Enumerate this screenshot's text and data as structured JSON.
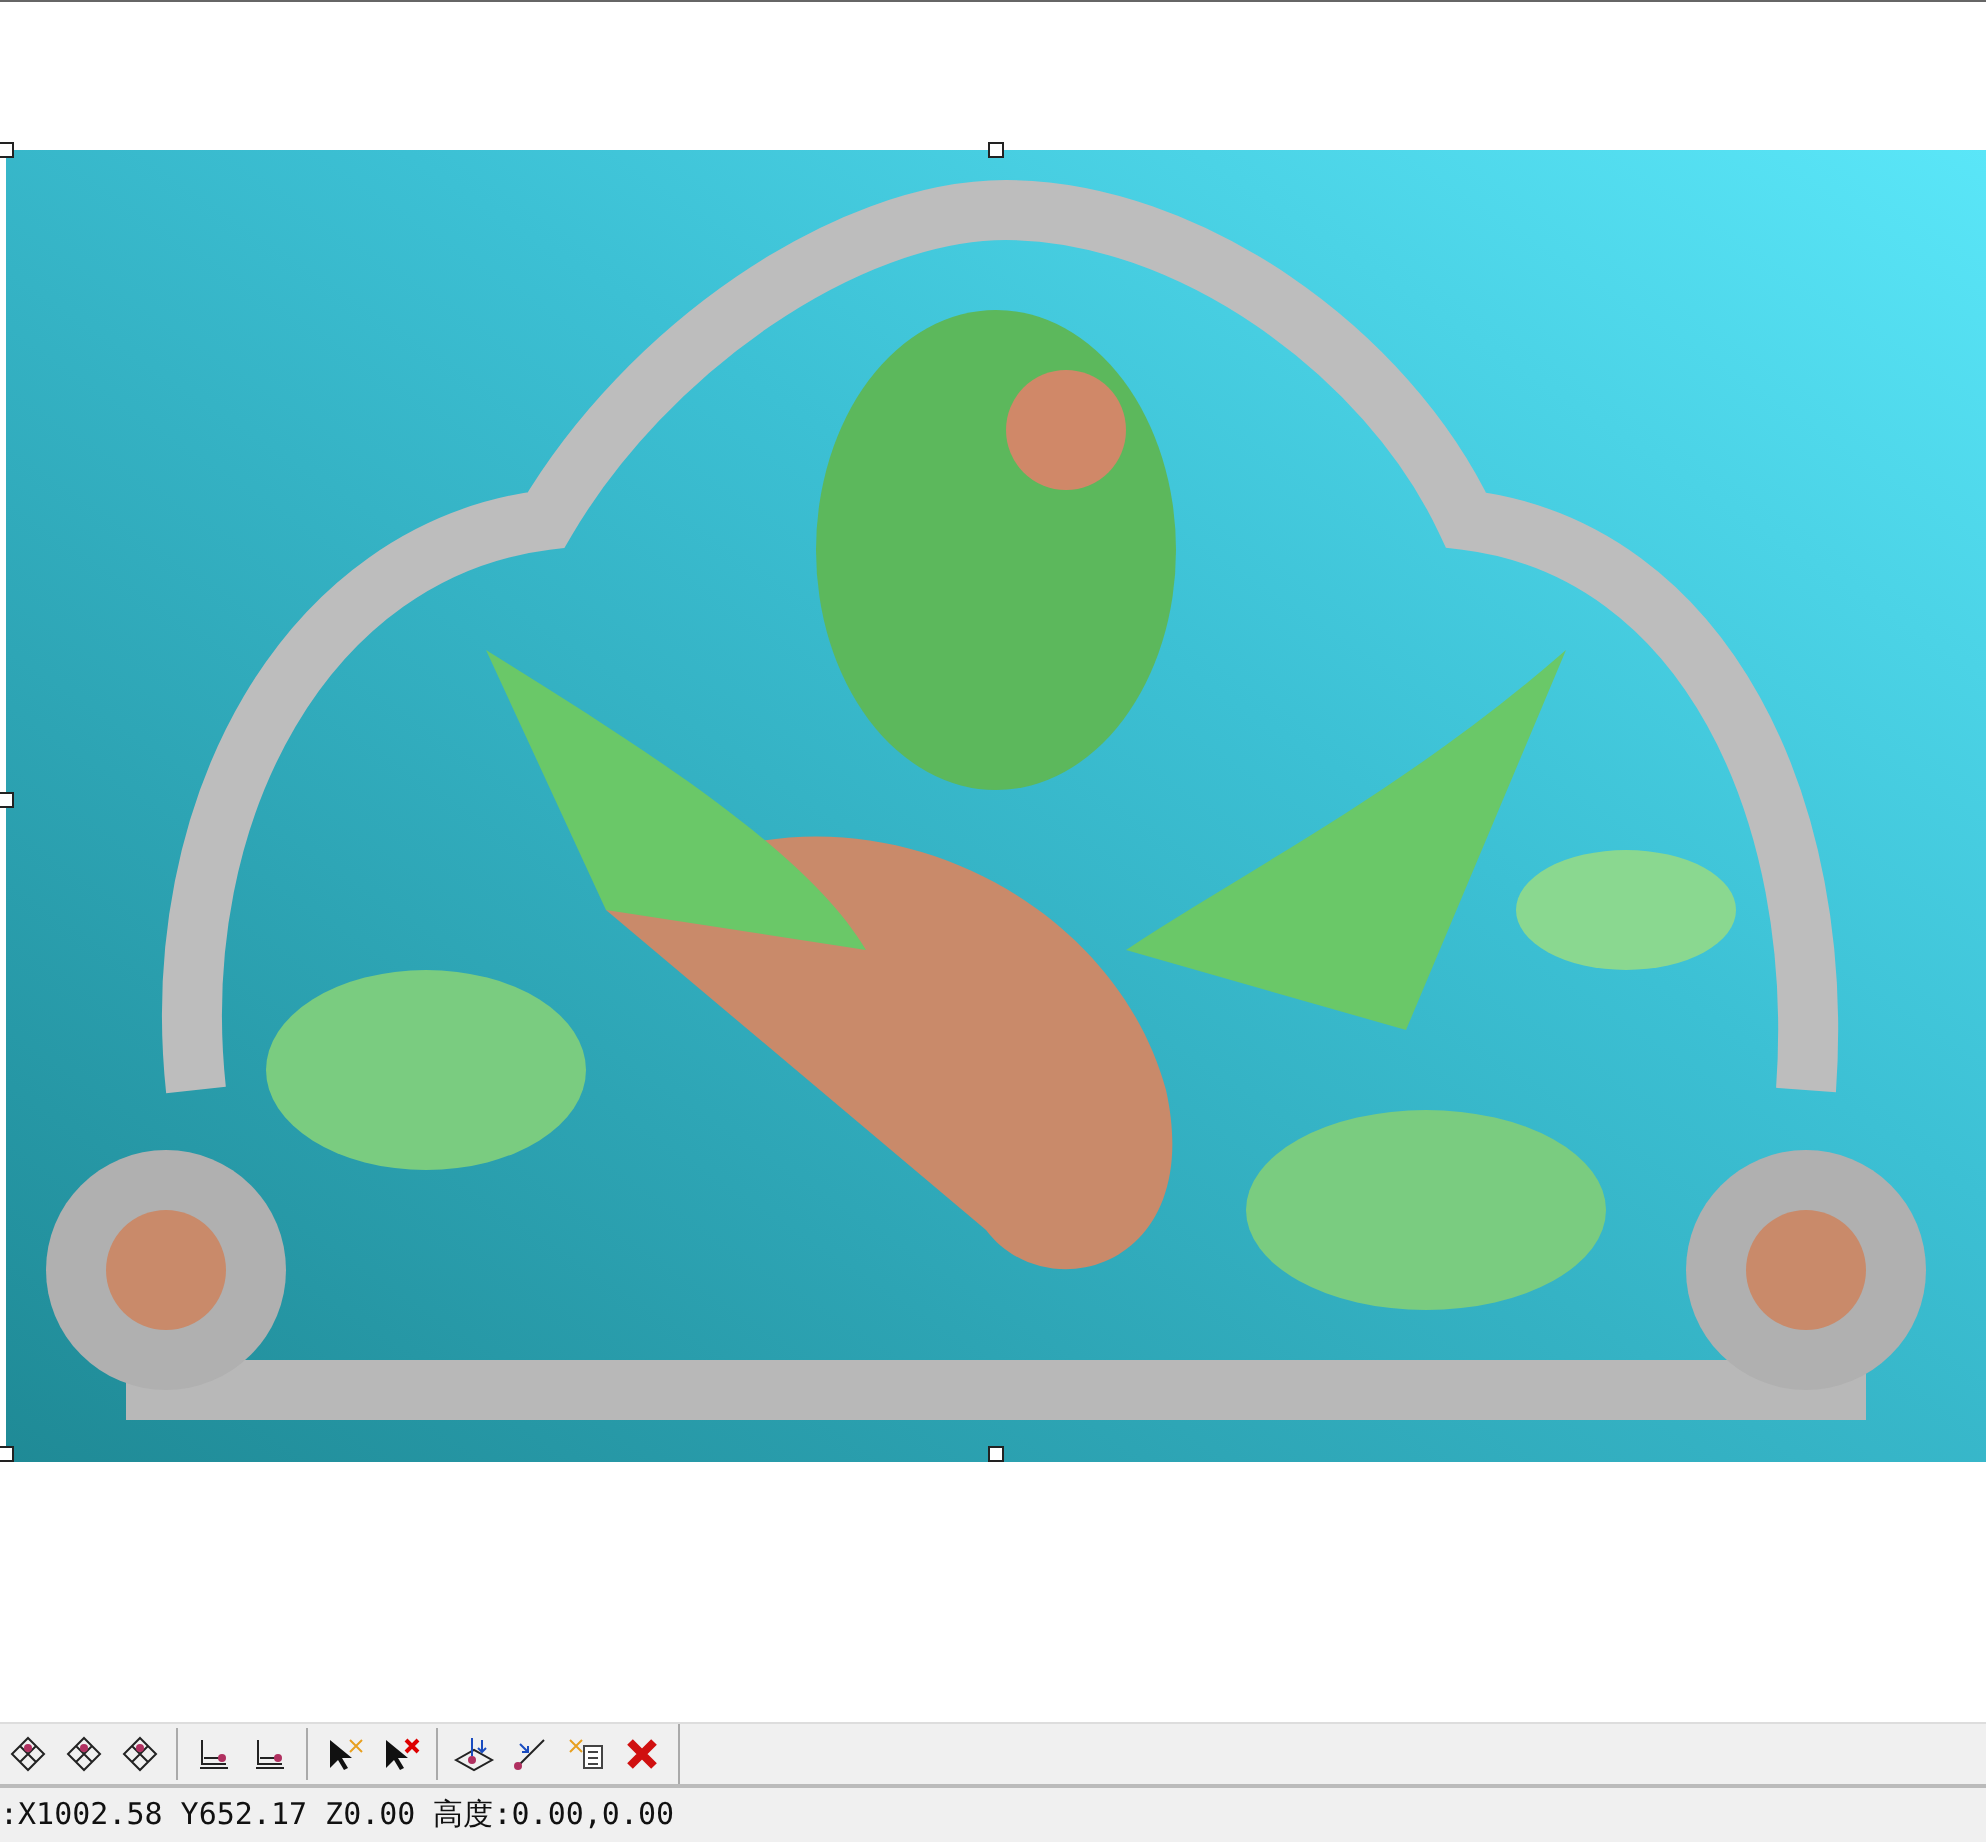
{
  "status_bar": {
    "text": ":X1002.58 Y652.17 Z0.00 高度:0.00,0.00"
  }
}
